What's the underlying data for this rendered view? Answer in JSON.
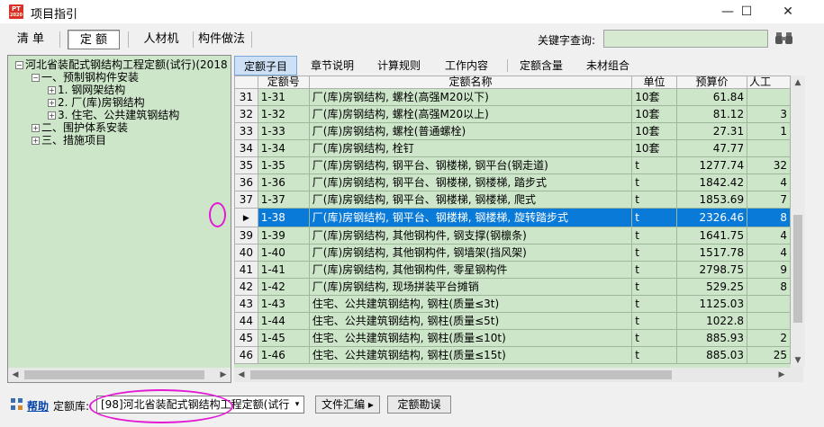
{
  "window": {
    "title": "项目指引",
    "icon_text": "PT",
    "icon_sub": "2020"
  },
  "window_controls": {
    "minimize": "—",
    "maximize": "☐",
    "close": "✕"
  },
  "toolbar": {
    "buttons": [
      {
        "label": "清  单",
        "active": false
      },
      {
        "label": "定  额",
        "active": true
      },
      {
        "label": "人材机",
        "active": false
      },
      {
        "label": "构件做法",
        "active": false
      }
    ],
    "keyword_label": "关键字查询:",
    "keyword_value": "",
    "search_icon": "binoculars-icon"
  },
  "tree": {
    "nodes": [
      {
        "label": "河北省装配式钢结构工程定额(试行)(2018",
        "expander": "−"
      },
      {
        "label": "一、预制钢构件安装",
        "expander": "−"
      },
      {
        "label": "1. 钢网架结构",
        "expander": "+"
      },
      {
        "label": "2. 厂(库)房钢结构",
        "expander": "+"
      },
      {
        "label": "3. 住宅、公共建筑钢结构",
        "expander": "+"
      },
      {
        "label": "二、围护体系安装",
        "expander": "+"
      },
      {
        "label": "三、措施项目",
        "expander": "+"
      }
    ]
  },
  "tabs": [
    "定额子目",
    "章节说明",
    "计算规则",
    "工作内容",
    "定额含量",
    "未材组合"
  ],
  "grid": {
    "columns": [
      "",
      "定额号",
      "定额名称",
      "单位",
      "预算价",
      "人工"
    ],
    "rows": [
      {
        "n": "31",
        "code": "1-31",
        "name": "厂(库)房钢结构, 螺栓(高强M20以下)",
        "unit": "10套",
        "price": "61.84",
        "labor": ""
      },
      {
        "n": "32",
        "code": "1-32",
        "name": "厂(库)房钢结构, 螺栓(高强M20以上)",
        "unit": "10套",
        "price": "81.12",
        "labor": "3"
      },
      {
        "n": "33",
        "code": "1-33",
        "name": "厂(库)房钢结构, 螺栓(普通螺栓)",
        "unit": "10套",
        "price": "27.31",
        "labor": "1"
      },
      {
        "n": "34",
        "code": "1-34",
        "name": "厂(库)房钢结构, 栓钉",
        "unit": "10套",
        "price": "47.77",
        "labor": ""
      },
      {
        "n": "35",
        "code": "1-35",
        "name": "厂(库)房钢结构, 钢平台、钢楼梯, 钢平台(钢走道)",
        "unit": "t",
        "price": "1277.74",
        "labor": "32"
      },
      {
        "n": "36",
        "code": "1-36",
        "name": "厂(库)房钢结构, 钢平台、钢楼梯, 钢楼梯, 踏步式",
        "unit": "t",
        "price": "1842.42",
        "labor": "4"
      },
      {
        "n": "37",
        "code": "1-37",
        "name": "厂(库)房钢结构, 钢平台、钢楼梯, 钢楼梯, 爬式",
        "unit": "t",
        "price": "1853.69",
        "labor": "7"
      },
      {
        "n": "38",
        "code": "1-38",
        "name": "厂(库)房钢结构, 钢平台、钢楼梯, 钢楼梯, 旋转踏步式",
        "unit": "t",
        "price": "2326.46",
        "labor": "8",
        "selected": true
      },
      {
        "n": "39",
        "code": "1-39",
        "name": "厂(库)房钢结构, 其他钢构件, 钢支撑(钢檩条)",
        "unit": "t",
        "price": "1641.75",
        "labor": "4"
      },
      {
        "n": "40",
        "code": "1-40",
        "name": "厂(库)房钢结构, 其他钢构件, 钢墙架(挡风架)",
        "unit": "t",
        "price": "1517.78",
        "labor": "4"
      },
      {
        "n": "41",
        "code": "1-41",
        "name": "厂(库)房钢结构, 其他钢构件, 零星钢构件",
        "unit": "t",
        "price": "2798.75",
        "labor": "9"
      },
      {
        "n": "42",
        "code": "1-42",
        "name": "厂(库)房钢结构, 现场拼装平台摊销",
        "unit": "t",
        "price": "529.25",
        "labor": "8"
      },
      {
        "n": "43",
        "code": "1-43",
        "name": "住宅、公共建筑钢结构, 钢柱(质量≤3t)",
        "unit": "t",
        "price": "1125.03",
        "labor": ""
      },
      {
        "n": "44",
        "code": "1-44",
        "name": "住宅、公共建筑钢结构, 钢柱(质量≤5t)",
        "unit": "t",
        "price": "1022.8",
        "labor": ""
      },
      {
        "n": "45",
        "code": "1-45",
        "name": "住宅、公共建筑钢结构, 钢柱(质量≤10t)",
        "unit": "t",
        "price": "885.93",
        "labor": "2"
      },
      {
        "n": "46",
        "code": "1-46",
        "name": "住宅、公共建筑钢结构, 钢柱(质量≤15t)",
        "unit": "t",
        "price": "885.03",
        "labor": "25"
      }
    ]
  },
  "statusbar": {
    "help_label": "帮助",
    "library_label": "定额库:",
    "library_value": "[98]河北省装配式钢结构工程定额(试行",
    "btn_summary": "文件汇编 ▸",
    "btn_errata": "定额勘误"
  },
  "annotation_color": "#e21ad4"
}
